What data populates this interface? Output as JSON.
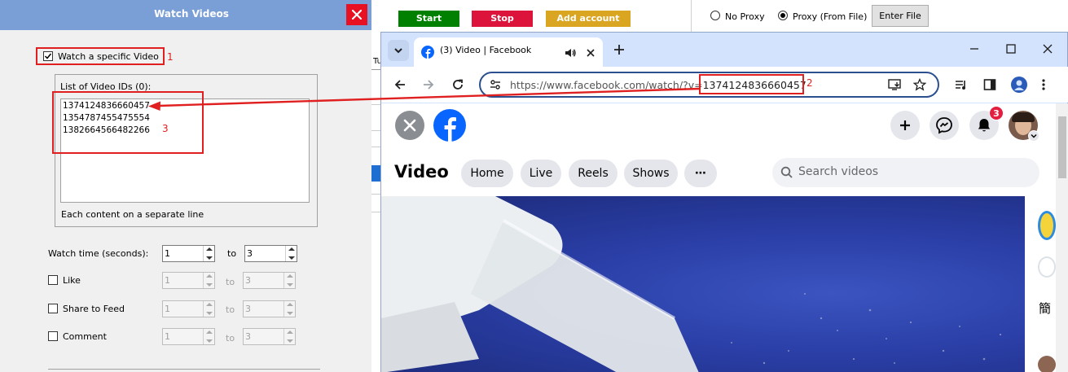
{
  "dialog": {
    "title": "Watch Videos",
    "watch_specific_label": "Watch a specific Video",
    "list_label": "List of Video IDs (0):",
    "video_ids": [
      "1374124836660457",
      "1354787455475554",
      "1382664566482266"
    ],
    "hint": "Each content on a separate line",
    "watch_time_label": "Watch time (seconds):",
    "watch_time_from": "1",
    "watch_time_to": "3",
    "to_label": "to",
    "like_label": "Like",
    "like_from": "1",
    "like_to": "3",
    "share_label": "Share to Feed",
    "share_from": "1",
    "share_to": "3",
    "comment_label": "Comment",
    "comment_from": "1",
    "comment_to": "3"
  },
  "annotations": {
    "n1": "1",
    "n2": "2",
    "n3": "3"
  },
  "app": {
    "start_label": "Start",
    "stop_label": "Stop",
    "add_account_label": "Add account",
    "no_proxy_label": "No Proxy",
    "proxy_file_label": "Proxy (From File)",
    "enter_file_label": "Enter File",
    "fragment_tu": "Tu"
  },
  "browser": {
    "tab_title": "(3) Video | Facebook",
    "url_prefix": "https://www.facebook.com/watch/?v=",
    "url_id": "1374124836660457"
  },
  "facebook": {
    "heading": "Video",
    "nav": [
      "Home",
      "Live",
      "Reels",
      "Shows",
      "⋯"
    ],
    "search_placeholder": "Search videos",
    "notification_count": "3",
    "side_fragment": "簡"
  },
  "colors": {
    "dialog_title_bar": "#7a9ed6",
    "close_red": "#e81123",
    "start_green": "#008000",
    "stop_red": "#dc143c",
    "add_account_gold": "#daa520",
    "annotation_red": "#e02020",
    "facebook_blue": "#0866ff"
  }
}
